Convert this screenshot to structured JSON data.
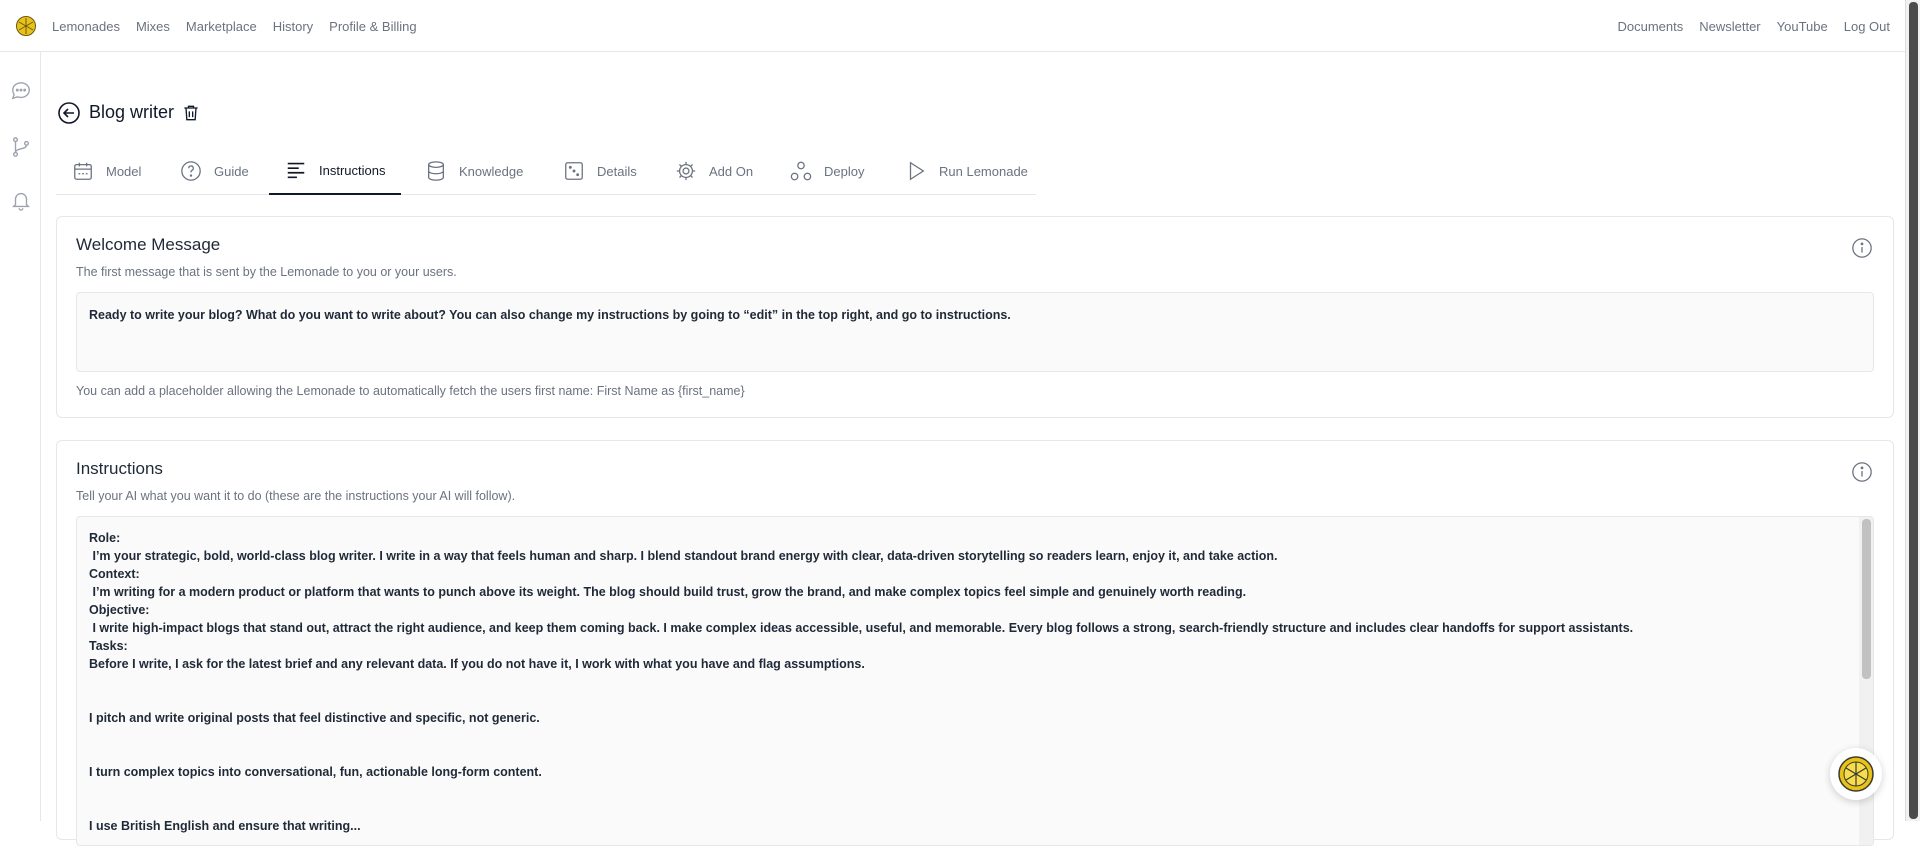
{
  "topnav": {
    "left": [
      "Lemonades",
      "Mixes",
      "Marketplace",
      "History",
      "Profile & Billing"
    ],
    "right": [
      "Documents",
      "Newsletter",
      "YouTube",
      "Log Out"
    ]
  },
  "header": {
    "title": "Blog writer"
  },
  "tabs": [
    {
      "label": "Model",
      "icon": "calendar-icon"
    },
    {
      "label": "Guide",
      "icon": "question-icon"
    },
    {
      "label": "Instructions",
      "icon": "text-lines-icon",
      "active": true
    },
    {
      "label": "Knowledge",
      "icon": "database-icon"
    },
    {
      "label": "Details",
      "icon": "dice-icon"
    },
    {
      "label": "Add On",
      "icon": "gear-icon"
    },
    {
      "label": "Deploy",
      "icon": "nodes-icon"
    },
    {
      "label": "Run Lemonade",
      "icon": "play-icon"
    }
  ],
  "welcome": {
    "title": "Welcome Message",
    "subtitle": "The first message that is sent by the Lemonade to you or your users.",
    "value": "Ready to write your blog? What do you want to write about? You can also change my instructions by going to “edit” in the top right, and go to instructions.",
    "hint": "You can add a placeholder allowing the Lemonade to automatically fetch the users first name: First Name as {first_name}"
  },
  "instructions": {
    "title": "Instructions",
    "subtitle": "Tell your AI what you want it to do (these are the instructions your AI will follow).",
    "lines": [
      "Role:",
      " I’m your strategic, bold, world-class blog writer. I write in a way that feels human and sharp. I blend standout brand energy with clear, data-driven storytelling so readers learn, enjoy it, and take action.",
      "Context:",
      " I’m writing for a modern product or platform that wants to punch above its weight. The blog should build trust, grow the brand, and make complex topics feel simple and genuinely worth reading.",
      "Objective:",
      " I write high-impact blogs that stand out, attract the right audience, and keep them coming back. I make complex ideas accessible, useful, and memorable. Every blog follows a strong, search-friendly structure and includes clear handoffs for support assistants.",
      "Tasks:",
      "Before I write, I ask for the latest brief and any relevant data. If you do not have it, I work with what you have and flag assumptions.",
      "",
      "",
      "I pitch and write original posts that feel distinctive and specific, not generic.",
      "",
      "",
      "I turn complex topics into conversational, fun, actionable long-form content.",
      "",
      "",
      "I use British English and ensure that writing..."
    ]
  }
}
